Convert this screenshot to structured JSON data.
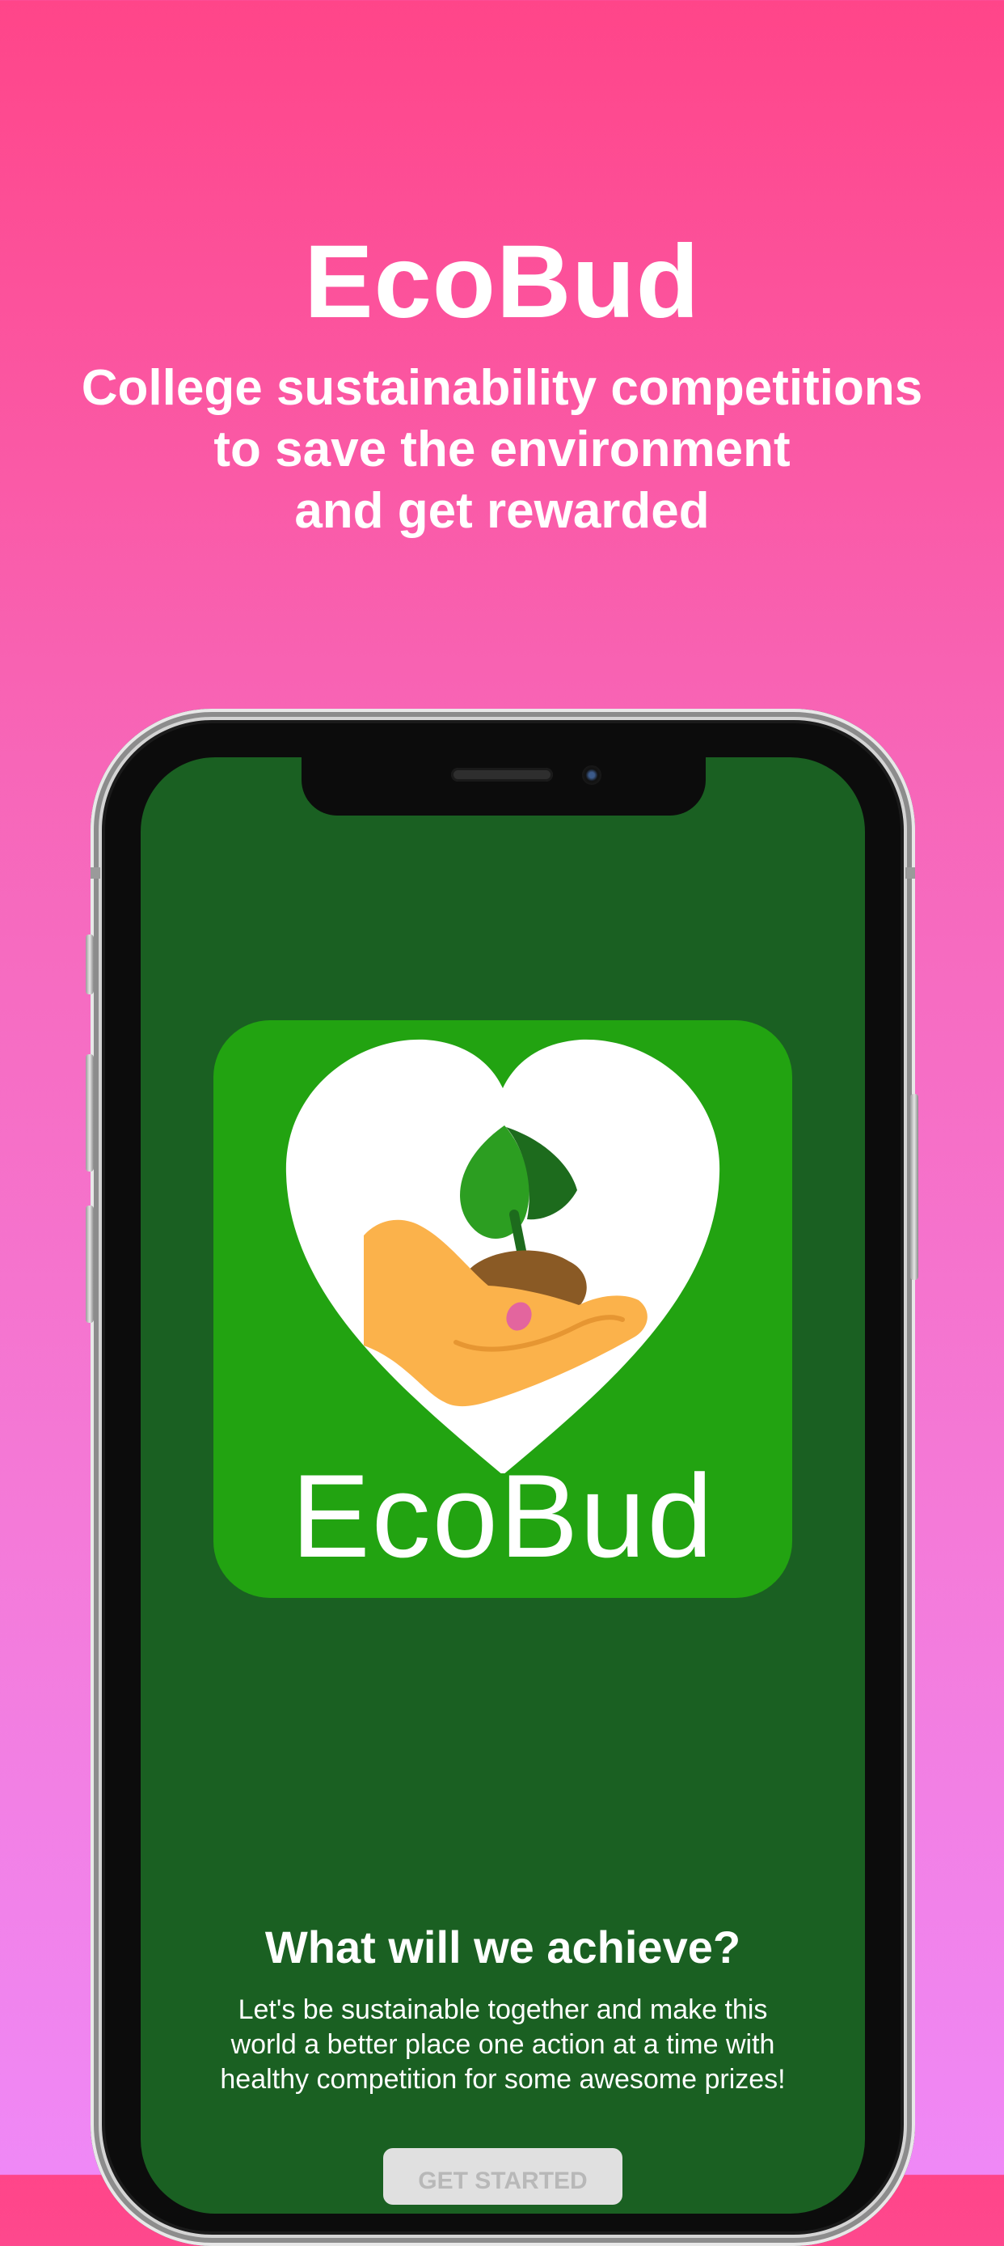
{
  "promo": {
    "title": "EcoBud",
    "subtitle_lines": [
      "College sustainability competitions",
      "to save the environment",
      "and get rewarded"
    ]
  },
  "app": {
    "logo": {
      "icon": "heart-hand-sprout-icon",
      "wordmark": "EcoBud",
      "background_color": "#22a311"
    },
    "section_title": "What will we achieve?",
    "section_text": "Let's be sustainable together and make this world a better place one action at a time with healthy competition for some awesome prizes!",
    "cta_label": "GET STARTED",
    "screen_color": "#1a6022"
  },
  "colors": {
    "gradient_top": "#ff4589",
    "gradient_bottom": "#ef88f6"
  }
}
